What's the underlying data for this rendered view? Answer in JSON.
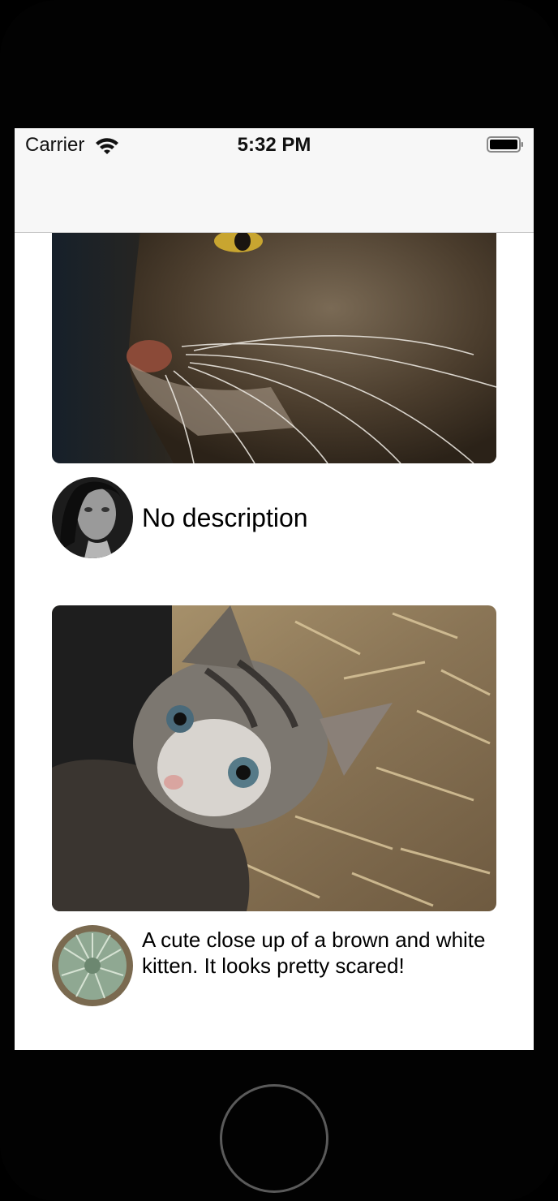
{
  "status_bar": {
    "carrier": "Carrier",
    "time": "5:32 PM",
    "icons": [
      "wifi-icon",
      "battery-icon"
    ]
  },
  "feed": {
    "posts": [
      {
        "photo": "cat close-up photo",
        "avatar": "woman portrait avatar",
        "description": "No description"
      },
      {
        "photo": "kitten in straw photo",
        "avatar": "succulent avatar",
        "description": "A cute close up of a brown and white kitten. It looks pretty scared!"
      }
    ]
  },
  "colors": {
    "bezel": "#020202",
    "status_bar_bg": "#f7f7f7",
    "nav_border": "#c8c8c8",
    "text": "#000000"
  }
}
